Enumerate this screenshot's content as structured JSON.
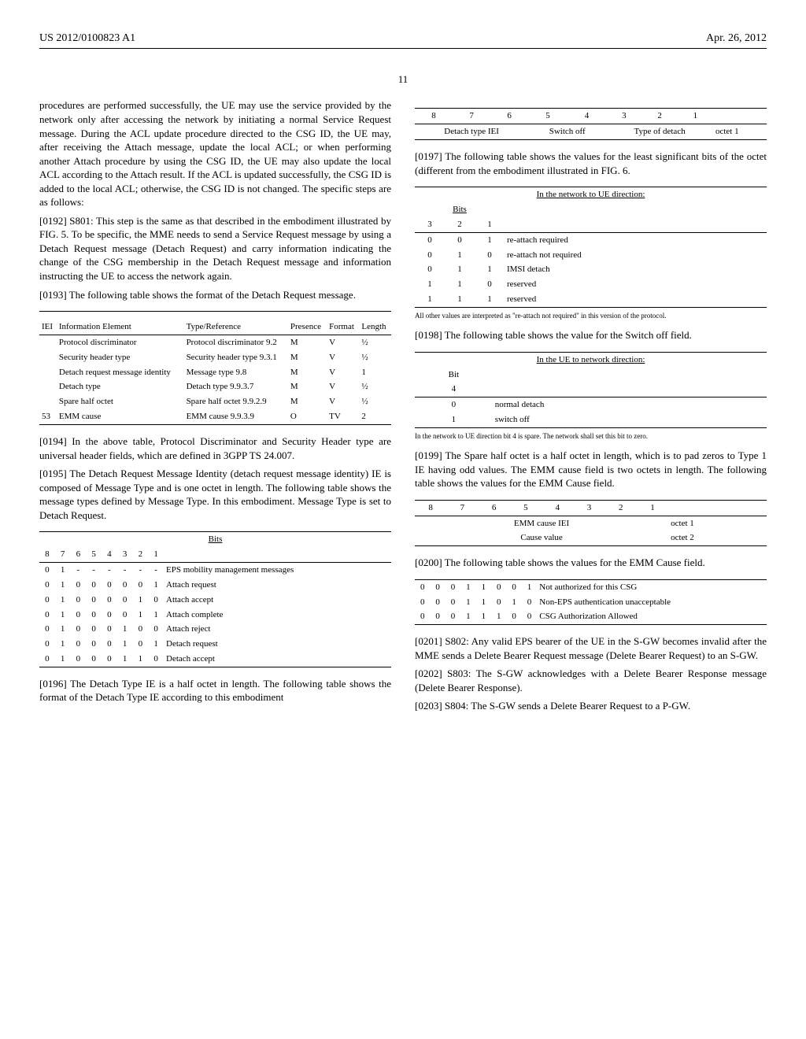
{
  "header": {
    "doc_id": "US 2012/0100823 A1",
    "date": "Apr. 26, 2012"
  },
  "page_number": "11",
  "left": {
    "intro": "procedures are performed successfully, the UE may use the service provided by the network only after accessing the network by initiating a normal Service Request message. During the ACL update procedure directed to the CSG ID, the UE may, after receiving the Attach message, update the local ACL; or when performing another Attach procedure by using the CSG ID, the UE may also update the local ACL according to the Attach result. If the ACL is updated successfully, the CSG ID is added to the local ACL; otherwise, the CSG ID is not changed. The specific steps are as follows:",
    "p0192_label": "[0192]",
    "p0192": " S801: This step is the same as that described in the embodiment illustrated by FIG. 5. To be specific, the MME needs to send a Service Request message by using a Detach Request message (Detach Request) and carry information indicating the change of the CSG membership in the Detach Request message and information instructing the UE to access the network again.",
    "p0193_label": "[0193]",
    "p0193": " The following table shows the format of the Detach Request message.",
    "table1": {
      "cols": [
        "IEI",
        "Information Element",
        "Type/Reference",
        "Presence",
        "Format",
        "Length"
      ],
      "rows": [
        [
          "",
          "Protocol discriminator",
          "Protocol discriminator 9.2",
          "M",
          "V",
          "½"
        ],
        [
          "",
          "Security header type",
          "Security header type 9.3.1",
          "M",
          "V",
          "½"
        ],
        [
          "",
          "Detach request message identity",
          "Message type 9.8",
          "M",
          "V",
          "1"
        ],
        [
          "",
          "Detach type",
          "Detach type 9.9.3.7",
          "M",
          "V",
          "½"
        ],
        [
          "",
          "Spare half octet",
          "Spare half octet 9.9.2.9",
          "M",
          "V",
          "½"
        ],
        [
          "53",
          "EMM cause",
          "EMM cause 9.9.3.9",
          "O",
          "TV",
          "2"
        ]
      ]
    },
    "p0194_label": "[0194]",
    "p0194": " In the above table, Protocol Discriminator and Security Header type are universal header fields, which are defined in 3GPP TS 24.007.",
    "p0195_label": "[0195]",
    "p0195": " The Detach Request Message Identity (detach request message identity) IE is composed of Message Type and is one octet in length. The following table shows the message types defined by Message Type. In this embodiment. Message Type is set to Detach Request.",
    "table2": {
      "bits_header": "Bits",
      "cols": [
        "8",
        "7",
        "6",
        "5",
        "4",
        "3",
        "2",
        "1",
        ""
      ],
      "rows": [
        [
          "0",
          "1",
          "-",
          "-",
          "-",
          "-",
          "-",
          "-",
          "EPS mobility management messages"
        ],
        [
          "0",
          "1",
          "0",
          "0",
          "0",
          "0",
          "0",
          "1",
          "Attach request"
        ],
        [
          "0",
          "1",
          "0",
          "0",
          "0",
          "0",
          "1",
          "0",
          "Attach accept"
        ],
        [
          "0",
          "1",
          "0",
          "0",
          "0",
          "0",
          "1",
          "1",
          "Attach complete"
        ],
        [
          "0",
          "1",
          "0",
          "0",
          "0",
          "1",
          "0",
          "0",
          "Attach reject"
        ],
        [
          "0",
          "1",
          "0",
          "0",
          "0",
          "1",
          "0",
          "1",
          "Detach request"
        ],
        [
          "0",
          "1",
          "0",
          "0",
          "0",
          "1",
          "1",
          "0",
          "Detach accept"
        ]
      ]
    },
    "p0196_label": "[0196]",
    "p0196": " The Detach Type IE is a half octet in length. The following table shows the format of the Detach Type IE according to this embodiment"
  },
  "right": {
    "table3": {
      "cols": [
        "8",
        "7",
        "6",
        "5",
        "4",
        "3",
        "2",
        "1",
        ""
      ],
      "row": [
        "Detach type IEI",
        "Switch off",
        "Type of detach",
        "octet 1"
      ]
    },
    "p0197_label": "[0197]",
    "p0197": " The following table shows the values for the least significant bits of the octet (different from the embodiment illustrated in FIG. 6.",
    "table4": {
      "direction": "In the network to UE direction:",
      "bits_header": "Bits",
      "cols": [
        "3",
        "2",
        "1",
        ""
      ],
      "rows": [
        [
          "0",
          "0",
          "1",
          "re-attach required"
        ],
        [
          "0",
          "1",
          "0",
          "re-attach not required"
        ],
        [
          "0",
          "1",
          "1",
          "IMSI detach"
        ],
        [
          "1",
          "1",
          "0",
          "reserved"
        ],
        [
          "1",
          "1",
          "1",
          "reserved"
        ]
      ],
      "footnote": "All other values are interpreted as \"re-attach not required\" in this version of the protocol."
    },
    "p0198_label": "[0198]",
    "p0198": " The following table shows the value for the Switch off field.",
    "table5": {
      "direction": "In the UE to network direction:",
      "bit_header": "Bit",
      "bit_col": "4",
      "rows": [
        [
          "0",
          "normal detach"
        ],
        [
          "1",
          "switch off"
        ]
      ],
      "footnote": "In the network to UE direction bit 4 is spare. The network shall set this bit to zero."
    },
    "p0199_label": "[0199]",
    "p0199": " The Spare half octet is a half octet in length, which is to pad zeros to Type 1 IE having odd values. The EMM cause field is two octets in length. The following table shows the values for the EMM Cause field.",
    "table6": {
      "cols": [
        "8",
        "7",
        "6",
        "5",
        "4",
        "3",
        "2",
        "1",
        ""
      ],
      "rows": [
        [
          "EMM cause IEI",
          "octet 1"
        ],
        [
          "Cause value",
          "octet 2"
        ]
      ]
    },
    "p0200_label": "[0200]",
    "p0200": " The following table shows the values for the EMM Cause field.",
    "table7": {
      "rows": [
        [
          "0",
          "0",
          "0",
          "1",
          "1",
          "0",
          "0",
          "1",
          "Not authorized for this CSG"
        ],
        [
          "0",
          "0",
          "0",
          "1",
          "1",
          "0",
          "1",
          "0",
          "Non-EPS authentication unacceptable"
        ],
        [
          "0",
          "0",
          "0",
          "1",
          "1",
          "1",
          "0",
          "0",
          "CSG Authorization Allowed"
        ]
      ]
    },
    "p0201_label": "[0201]",
    "p0201": " S802: Any valid EPS bearer of the UE in the S-GW becomes invalid after the MME sends a Delete Bearer Request message (Delete Bearer Request) to an S-GW.",
    "p0202_label": "[0202]",
    "p0202": " S803: The S-GW acknowledges with a Delete Bearer Response message (Delete Bearer Response).",
    "p0203_label": "[0203]",
    "p0203": " S804: The S-GW sends a Delete Bearer Request to a P-GW."
  }
}
